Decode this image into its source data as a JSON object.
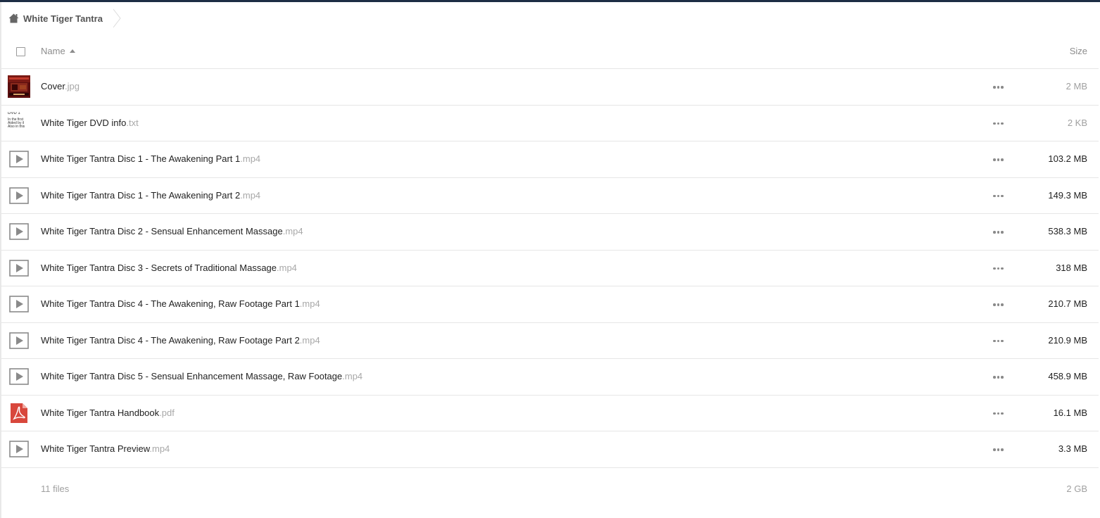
{
  "breadcrumb": {
    "home_label": "White Tiger Tantra"
  },
  "table": {
    "header_name": "Name",
    "header_size": "Size",
    "rows": [
      {
        "base": "Cover",
        "ext": ".jpg",
        "size": "2 MB",
        "icon": "image-thumbnail"
      },
      {
        "base": "White Tiger DVD info",
        "ext": ".txt",
        "size": "2 KB",
        "icon": "text-thumbnail",
        "preview": [
          "DVD 1",
          "In the first",
          "Aided by il",
          "Also in this"
        ]
      },
      {
        "base": "White Tiger Tantra Disc 1 - The Awakening Part 1",
        "ext": ".mp4",
        "size": "103.2 MB",
        "icon": "video-icon"
      },
      {
        "base": "White Tiger Tantra Disc 1 - The Awakening Part 2",
        "ext": ".mp4",
        "size": "149.3 MB",
        "icon": "video-icon"
      },
      {
        "base": "White Tiger Tantra Disc 2 - Sensual Enhancement Massage",
        "ext": ".mp4",
        "size": "538.3 MB",
        "icon": "video-icon"
      },
      {
        "base": "White Tiger Tantra Disc 3 - Secrets of Traditional Massage",
        "ext": ".mp4",
        "size": "318 MB",
        "icon": "video-icon"
      },
      {
        "base": "White Tiger Tantra Disc 4 - The Awakening, Raw Footage Part 1",
        "ext": ".mp4",
        "size": "210.7 MB",
        "icon": "video-icon"
      },
      {
        "base": "White Tiger Tantra Disc 4 - The Awakening, Raw Footage Part 2",
        "ext": ".mp4",
        "size": "210.9 MB",
        "icon": "video-icon"
      },
      {
        "base": "White Tiger Tantra Disc 5 - Sensual Enhancement Massage, Raw Footage",
        "ext": ".mp4",
        "size": "458.9 MB",
        "icon": "video-icon"
      },
      {
        "base": "White Tiger Tantra Handbook",
        "ext": ".pdf",
        "size": "16.1 MB",
        "icon": "pdf-icon"
      },
      {
        "base": "White Tiger Tantra Preview",
        "ext": ".mp4",
        "size": "3.3 MB",
        "icon": "video-icon"
      }
    ]
  },
  "summary": {
    "count": "11 files",
    "total": "2 GB"
  },
  "colors": {
    "pdf_red": "#d8473c",
    "accent_bar": "#1d2d44"
  }
}
